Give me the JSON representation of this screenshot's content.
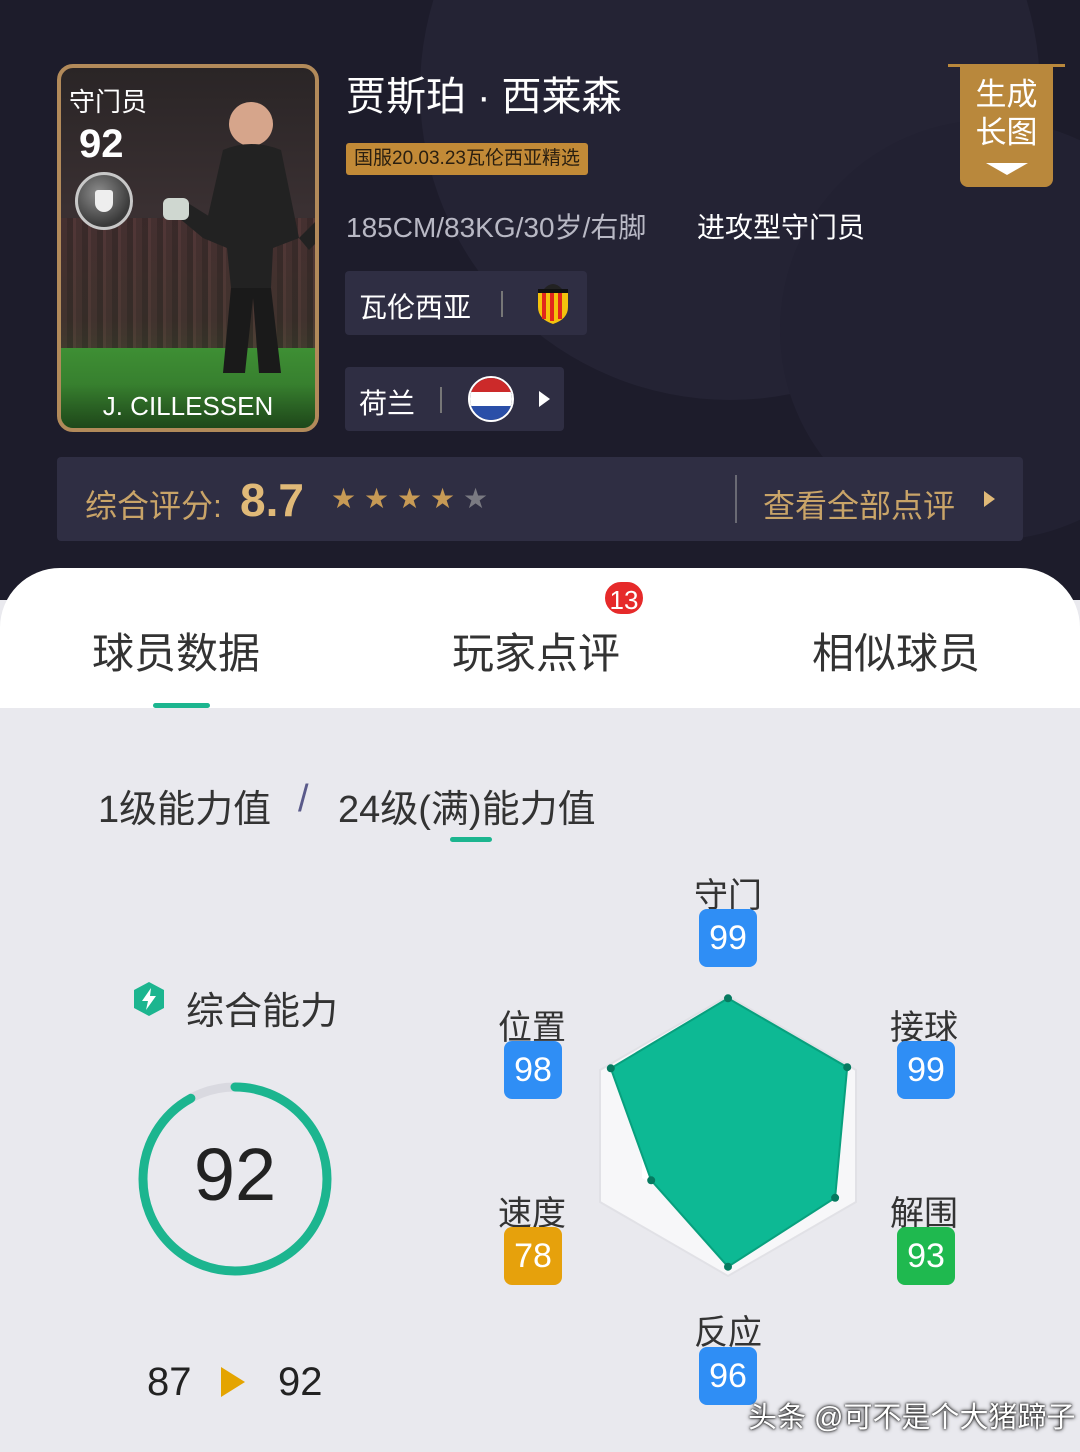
{
  "card": {
    "position": "守门员",
    "rating": "92",
    "name": "J. CILLESSEN"
  },
  "player": {
    "name": "贾斯珀 · 西莱森",
    "tag": "国服20.03.23瓦伦西亚精选",
    "info": "185CM/83KG/30岁/右脚",
    "role": "进攻型守门员",
    "club": "瓦伦西亚",
    "nation": "荷兰"
  },
  "generate_button": {
    "line1": "生成",
    "line2": "长图"
  },
  "rating": {
    "label": "综合评分:",
    "value": "8.7",
    "stars": 4,
    "view_all": "查看全部点评"
  },
  "tabs": [
    {
      "label": "球员数据",
      "active": true
    },
    {
      "label": "玩家点评",
      "badge": "13"
    },
    {
      "label": "相似球员"
    }
  ],
  "level": {
    "level1": "1级能力值",
    "slash": "/",
    "level24": "24级(满)能力值"
  },
  "overall": {
    "label": "综合能力",
    "value": "92",
    "progress": 0.92,
    "from": "87",
    "to": "92"
  },
  "stats": [
    {
      "label": "守门",
      "value": "99",
      "color": "#2f8ef5"
    },
    {
      "label": "接球",
      "value": "99",
      "color": "#2f8ef5"
    },
    {
      "label": "解围",
      "value": "93",
      "color": "#1fb94f"
    },
    {
      "label": "反应",
      "value": "96",
      "color": "#2f8ef5"
    },
    {
      "label": "速度",
      "value": "78",
      "color": "#e6a10c"
    },
    {
      "label": "位置",
      "value": "98",
      "color": "#2f8ef5"
    }
  ],
  "colors": {
    "accent": "#1cb58f",
    "gold": "#c9a468",
    "dark_bg": "#1d1c2b",
    "panel": "#2f2e43"
  },
  "watermark": "头条 @可不是个大猪蹄子"
}
